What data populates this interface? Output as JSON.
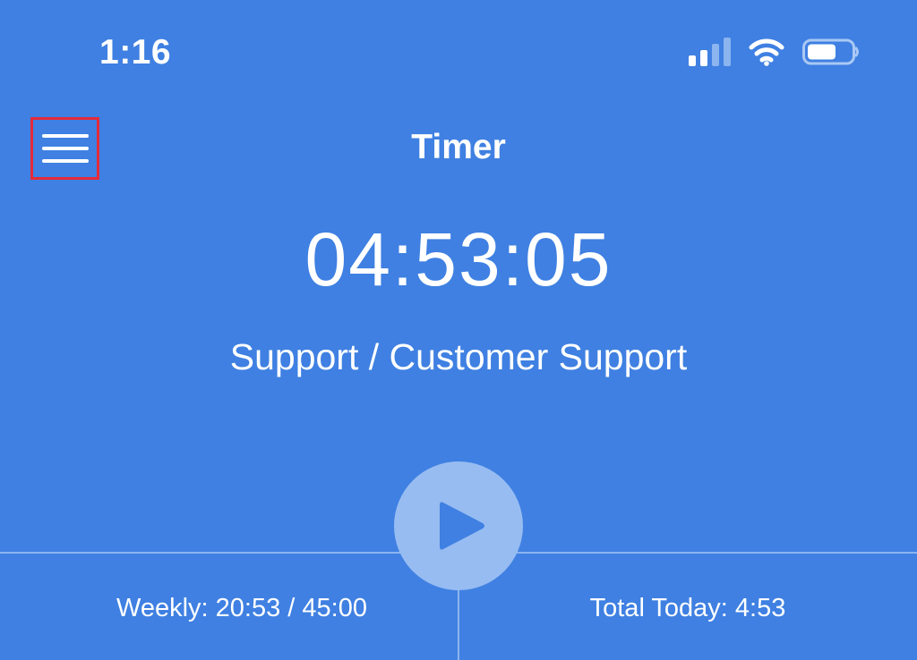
{
  "status_bar": {
    "time": "1:16",
    "icons": [
      "cellular-signal-icon",
      "wifi-icon",
      "battery-icon"
    ]
  },
  "header": {
    "title": "Timer",
    "menu_icon": "hamburger-menu-icon"
  },
  "timer": {
    "elapsed": "04:53:05",
    "project": "Support / Customer Support",
    "play_icon": "play-icon"
  },
  "stats": {
    "weekly": "Weekly: 20:53 / 45:00",
    "total_today": "Total Today: 4:53"
  },
  "colors": {
    "background": "#3f80e2",
    "play_button": "#97bcf1",
    "play_glyph": "#3f80e2",
    "divider": "#8cb4ef",
    "highlight": "#e52b3a",
    "text": "#ffffff"
  }
}
